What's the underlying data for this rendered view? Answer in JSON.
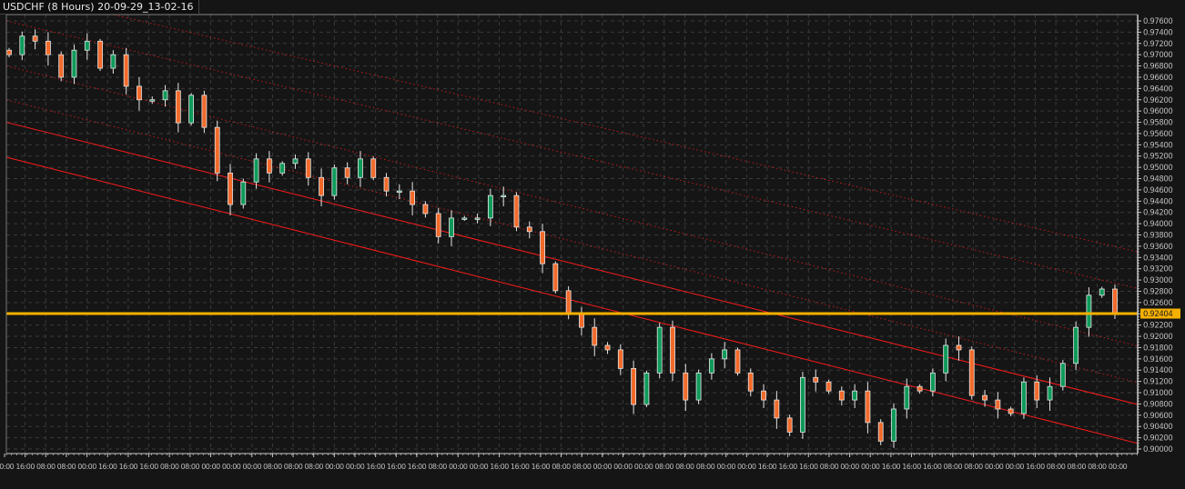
{
  "chart_data": {
    "type": "candlestick",
    "title": "USDCHF (8 Hours) 20-09-29_13-02-16",
    "symbol": "USDCHF",
    "timeframe": "8 Hours",
    "ylim": [
      0.9,
      0.976
    ],
    "y_ticks": [
      "0.97600",
      "0.97400",
      "0.97200",
      "0.97000",
      "0.96800",
      "0.96600",
      "0.96400",
      "0.96200",
      "0.96000",
      "0.95800",
      "0.95600",
      "0.95400",
      "0.95200",
      "0.95000",
      "0.94800",
      "0.94600",
      "0.94400",
      "0.94200",
      "0.94000",
      "0.93800",
      "0.93600",
      "0.93400",
      "0.93200",
      "0.93000",
      "0.92800",
      "0.92600",
      "0.92400",
      "0.92200",
      "0.92000",
      "0.91800",
      "0.91600",
      "0.91400",
      "0.91200",
      "0.91000",
      "0.90800",
      "0.90600",
      "0.90400",
      "0.90200",
      "0.90000"
    ],
    "x_ticks": [
      "00:00",
      "16:00",
      "08:00",
      "08:00",
      "00:00",
      "16:00",
      "16:00",
      "16:00",
      "08:00",
      "08:00",
      "00:00",
      "00:00",
      "00:00",
      "08:00",
      "08:00",
      "08:00",
      "00:00",
      "00:00",
      "16:00",
      "16:00",
      "16:00",
      "08:00",
      "00:00",
      "00:00",
      "16:00",
      "16:00",
      "16:00",
      "08:00",
      "08:00",
      "00:00",
      "00:00",
      "00:00",
      "08:00",
      "08:00",
      "08:00",
      "00:00",
      "00:00",
      "16:00",
      "16:00",
      "16:00",
      "08:00",
      "00:00",
      "00:00",
      "16:00",
      "16:00",
      "16:00",
      "08:00",
      "08:00",
      "00:00",
      "00:00",
      "16:00",
      "08:00",
      "08:00",
      "08:00",
      "00:00"
    ],
    "current_price": "0.92404",
    "current_price_value": 0.92404,
    "closes": [
      0.97,
      0.9733,
      0.9724,
      0.97,
      0.966,
      0.9708,
      0.9724,
      0.9676,
      0.97,
      0.9644,
      0.962,
      0.962,
      0.9636,
      0.9579,
      0.9628,
      0.9571,
      0.949,
      0.9434,
      0.9474,
      0.9515,
      0.949,
      0.9507,
      0.9515,
      0.9482,
      0.945,
      0.9499,
      0.9482,
      0.9515,
      0.9482,
      0.9458,
      0.9458,
      0.9434,
      0.9418,
      0.9377,
      0.941,
      0.941,
      0.941,
      0.945,
      0.945,
      0.9394,
      0.9386,
      0.9329,
      0.9281,
      0.924,
      0.9216,
      0.9184,
      0.9176,
      0.9143,
      0.9079,
      0.9135,
      0.9216,
      0.9135,
      0.9087,
      0.9135,
      0.916,
      0.9176,
      0.9135,
      0.9103,
      0.9087,
      0.9055,
      0.903,
      0.9127,
      0.9119,
      0.9103,
      0.9087,
      0.9103,
      0.9047,
      0.9014,
      0.9071,
      0.9111,
      0.9103,
      0.9135,
      0.9184,
      0.9176,
      0.9095,
      0.9087,
      0.9071,
      0.9063,
      0.9119,
      0.9087,
      0.9111,
      0.9152,
      0.9216,
      0.9273,
      0.9284,
      0.92404
    ],
    "channel_lines": [
      {
        "style": "solid",
        "start": 0.958,
        "end": 0.9079
      },
      {
        "style": "solid",
        "start": 0.9518,
        "end": 0.901
      },
      {
        "style": "dotted",
        "start": 0.968,
        "end": 0.9183
      },
      {
        "style": "dotted",
        "start": 0.962,
        "end": 0.9118
      },
      {
        "style": "dotted",
        "start": 0.976,
        "end": 0.9285
      },
      {
        "style": "dotted",
        "start": 0.9815,
        "end": 0.935
      }
    ],
    "colors": {
      "up": "#0f9a5a",
      "down": "#f26a2a",
      "wick": "#e6e6e6",
      "price_line": "#f5b000",
      "channel": "#ff1a1a",
      "grid": "#3a3a3a",
      "axis": "#c8c8c8"
    }
  }
}
